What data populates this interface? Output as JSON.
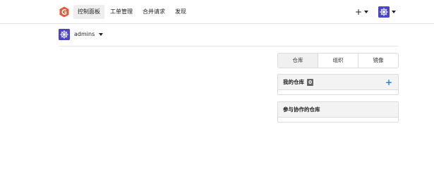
{
  "header": {
    "logo_icon": "gitea-logo-icon",
    "nav": [
      {
        "label": "控制面板",
        "active": true
      },
      {
        "label": "工单管理",
        "active": false
      },
      {
        "label": "合并请求",
        "active": false
      },
      {
        "label": "发现",
        "active": false
      }
    ],
    "create_icon": "plus-icon",
    "avatar_icon": "avatar-icon"
  },
  "context": {
    "username": "admins"
  },
  "dashboard": {
    "tabs": [
      "仓库",
      "组织",
      "镜像"
    ],
    "my_repos": {
      "title": "我的仓库",
      "count": "0",
      "add": "+"
    },
    "collab_repos": {
      "title": "参与协作的仓库"
    }
  },
  "colors": {
    "accent": "#2185d0",
    "avatar": "#4a44c8",
    "logo": "#e05a3c"
  }
}
